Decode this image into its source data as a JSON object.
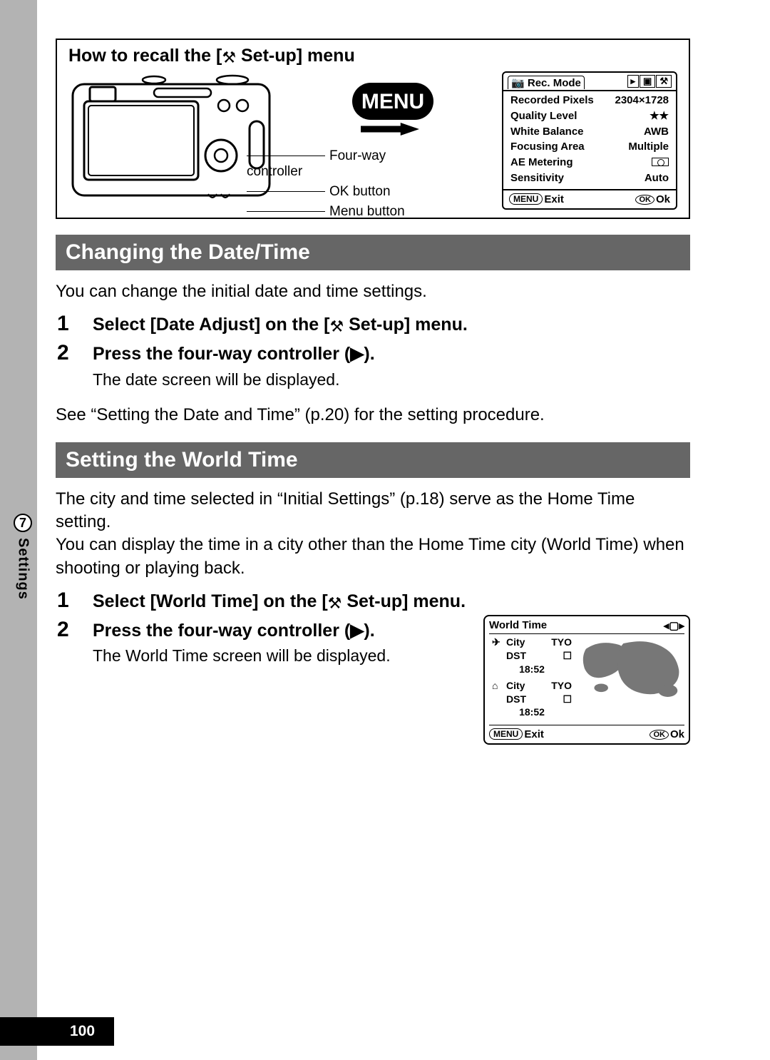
{
  "recall": {
    "title_pre": "How to recall the [",
    "title_post": " Set-up] menu",
    "labels": {
      "fourway": "Four-way controller",
      "ok": "OK button",
      "menu": "Menu button"
    },
    "menu_word": "MENU"
  },
  "rec_menu": {
    "tab_active": "Rec. Mode",
    "rows": [
      {
        "k": "Recorded Pixels",
        "v": "2304×1728"
      },
      {
        "k": "Quality Level",
        "v": "★★"
      },
      {
        "k": "White Balance",
        "v": "AWB"
      },
      {
        "k": "Focusing Area",
        "v": "Multiple"
      },
      {
        "k": "AE Metering",
        "v": "__metering__"
      },
      {
        "k": "Sensitivity",
        "v": "Auto"
      }
    ],
    "footer_exit": "Exit",
    "footer_ok": "Ok",
    "menu_label": "MENU",
    "ok_label": "OK"
  },
  "section1": {
    "heading": "Changing the Date/Time",
    "intro": "You can change the initial date and time settings.",
    "steps": [
      {
        "n": "1",
        "title_pre": "Select [Date Adjust] on the [",
        "title_post": " Set-up] menu."
      },
      {
        "n": "2",
        "title": "Press the four-way controller (▶).",
        "sub": "The date screen will be displayed."
      }
    ],
    "ref": "See “Setting the Date and Time” (p.20) for the setting procedure."
  },
  "section2": {
    "heading": "Setting the World Time",
    "intro": "The city and time selected in “Initial Settings” (p.18) serve as the Home Time setting.\nYou can display the time in a city other than the Home Time city (World Time) when shooting or playing back.",
    "steps": [
      {
        "n": "1",
        "title_pre": "Select [World Time] on the [",
        "title_post": " Set-up] menu."
      },
      {
        "n": "2",
        "title": "Press the four-way controller (▶).",
        "sub": "The World Time screen will be displayed."
      }
    ]
  },
  "wt_screen": {
    "title": "World Time",
    "city_label": "City",
    "dst_label": "DST",
    "dest_city": "TYO",
    "dest_time": "18:52",
    "home_city": "TYO",
    "home_time": "18:52",
    "footer_exit": "Exit",
    "footer_ok": "Ok",
    "menu_label": "MENU",
    "ok_label": "OK"
  },
  "side": {
    "chapter": "7",
    "label": "Settings"
  },
  "page_number": "100"
}
